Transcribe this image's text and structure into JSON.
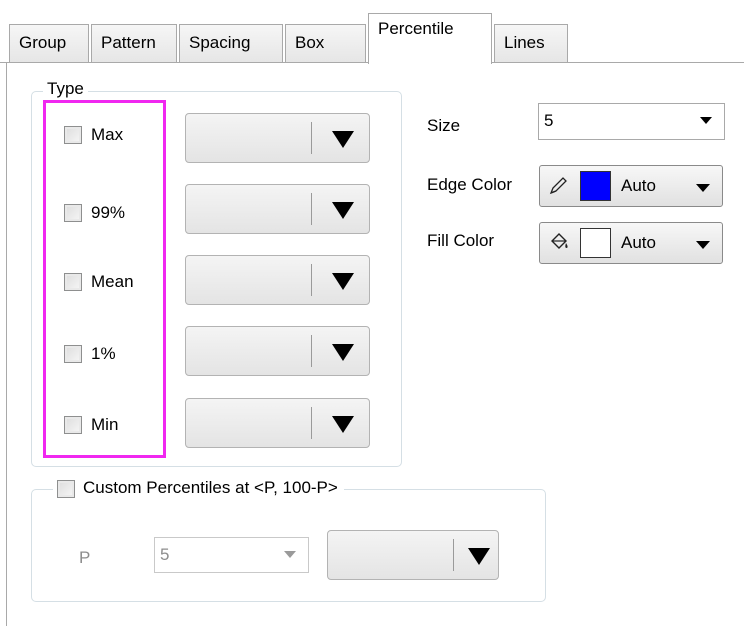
{
  "tabs": [
    "Group",
    "Pattern",
    "Spacing",
    "Box",
    "Percentile",
    "Lines"
  ],
  "active_tab": "Percentile",
  "type_group": {
    "title": "Type",
    "items": [
      {
        "label": "Max",
        "checked": false
      },
      {
        "label": "99%",
        "checked": false
      },
      {
        "label": "Mean",
        "checked": false
      },
      {
        "label": "1%",
        "checked": false
      },
      {
        "label": "Min",
        "checked": false
      }
    ]
  },
  "size": {
    "label": "Size",
    "value": "5"
  },
  "edge_color": {
    "label": "Edge Color",
    "value": "Auto",
    "swatch": "#0000ff"
  },
  "fill_color": {
    "label": "Fill Color",
    "value": "Auto",
    "swatch": "#ffffff"
  },
  "custom": {
    "label": "Custom Percentiles at <P, 100-P>",
    "checked": false,
    "p_label": "P",
    "p_value": "5"
  },
  "colors": {
    "highlight": "#f027f0",
    "border": "#a9a9a9"
  }
}
